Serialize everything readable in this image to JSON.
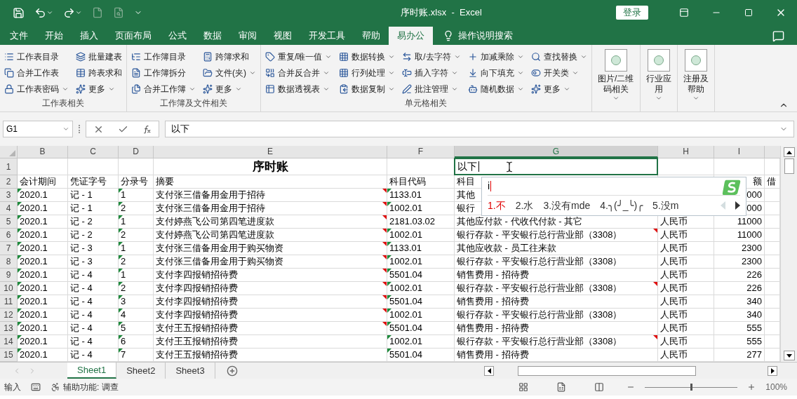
{
  "window": {
    "title": "序时账.xlsx  -  Excel",
    "sign_in": "登录"
  },
  "tabs": [
    {
      "label": "文件",
      "selected": false
    },
    {
      "label": "开始",
      "selected": false
    },
    {
      "label": "插入",
      "selected": false
    },
    {
      "label": "页面布局",
      "selected": false
    },
    {
      "label": "公式",
      "selected": false
    },
    {
      "label": "数据",
      "selected": false
    },
    {
      "label": "审阅",
      "selected": false
    },
    {
      "label": "视图",
      "selected": false
    },
    {
      "label": "开发工具",
      "selected": false
    },
    {
      "label": "帮助",
      "selected": false
    },
    {
      "label": "易办公",
      "selected": true
    }
  ],
  "tell_me": "操作说明搜索",
  "ribbon": {
    "groups": [
      {
        "label": "工作表相关",
        "columns": [
          [
            {
              "label": "工作表目录",
              "dropdown": false
            },
            {
              "label": "合并工作表",
              "dropdown": false
            },
            {
              "label": "工作表密码",
              "dropdown": true
            }
          ],
          [
            {
              "label": "批量建表",
              "dropdown": false
            },
            {
              "label": "跨表求和",
              "dropdown": false
            },
            {
              "label": "更多",
              "dropdown": true
            }
          ]
        ]
      },
      {
        "label": "工作簿及文件相关",
        "columns": [
          [
            {
              "label": "工作簿目录",
              "dropdown": false
            },
            {
              "label": "工作簿拆分",
              "dropdown": false
            },
            {
              "label": "合并工作簿",
              "dropdown": true
            }
          ],
          [
            {
              "label": "跨簿求和",
              "dropdown": false
            },
            {
              "label": "文件(夹)",
              "dropdown": true
            },
            {
              "label": "更多",
              "dropdown": true
            }
          ]
        ]
      },
      {
        "label": "单元格相关",
        "columns": [
          [
            {
              "label": "重复/唯一值",
              "dropdown": true
            },
            {
              "label": "合并反合并",
              "dropdown": true
            },
            {
              "label": "数据透视表",
              "dropdown": true
            }
          ],
          [
            {
              "label": "数据转换",
              "dropdown": true
            },
            {
              "label": "行列处理",
              "dropdown": true
            },
            {
              "label": "数据复制",
              "dropdown": true
            }
          ],
          [
            {
              "label": "取/去字符",
              "dropdown": true
            },
            {
              "label": "插入字符",
              "dropdown": true
            },
            {
              "label": "批注管理",
              "dropdown": true
            }
          ],
          [
            {
              "label": "加减乘除",
              "dropdown": true
            },
            {
              "label": "向下填充",
              "dropdown": true
            },
            {
              "label": "随机数据",
              "dropdown": true
            }
          ],
          [
            {
              "label": "查找替换",
              "dropdown": true
            },
            {
              "label": "开关类",
              "dropdown": true
            },
            {
              "label": "更多",
              "dropdown": true
            }
          ]
        ]
      }
    ],
    "large_buttons": [
      {
        "label": "图片/二维码相关"
      },
      {
        "label": "行业应用"
      },
      {
        "label": "注册及帮助"
      }
    ]
  },
  "formula_bar": {
    "name_box": "G1",
    "value": "以下"
  },
  "sheet": {
    "columns": [
      {
        "letter": "B",
        "selected": false
      },
      {
        "letter": "C",
        "selected": false
      },
      {
        "letter": "D",
        "selected": false
      },
      {
        "letter": "E",
        "selected": false
      },
      {
        "letter": "F",
        "selected": false
      },
      {
        "letter": "G",
        "selected": true
      },
      {
        "letter": "H",
        "selected": false
      },
      {
        "letter": "I",
        "selected": false
      }
    ],
    "rows": [
      {
        "num": "1",
        "kind": "title",
        "cells": [
          null,
          null,
          null,
          {
            "text": "序时账"
          },
          null,
          {
            "text": "以下",
            "active": true
          }
        ]
      },
      {
        "num": "2",
        "kind": "data",
        "cells": [
          {
            "text": "会计期间"
          },
          {
            "text": "凭证字号"
          },
          {
            "text": "分录号"
          },
          {
            "text": "摘要"
          },
          {
            "text": "科目代码"
          },
          {
            "text": "科目"
          },
          null,
          {
            "text": "额"
          },
          {
            "text": "借"
          }
        ]
      },
      {
        "num": "3",
        "kind": "data",
        "cells": [
          {
            "text": "2020.1",
            "error": true
          },
          {
            "text": "记 - 1"
          },
          {
            "text": "1",
            "error": true
          },
          {
            "text": "支付张三借备用金用于招待",
            "note": true
          },
          {
            "text": "1133.01",
            "error": true
          },
          {
            "text": "其他"
          },
          null,
          {
            "text": "000"
          }
        ]
      },
      {
        "num": "4",
        "kind": "data",
        "cells": [
          {
            "text": "2020.1",
            "error": true
          },
          {
            "text": "记 - 1"
          },
          {
            "text": "2",
            "error": true
          },
          {
            "text": "支付张三借备用金用于招待",
            "note": true
          },
          {
            "text": "1002.01",
            "error": true
          },
          {
            "text": "银行"
          },
          null,
          {
            "text": "000"
          }
        ]
      },
      {
        "num": "5",
        "kind": "data",
        "cells": [
          {
            "text": "2020.1",
            "error": true
          },
          {
            "text": "记 - 2"
          },
          {
            "text": "1",
            "error": true
          },
          {
            "text": "支付婷燕飞公司第四笔进度款",
            "note": true
          },
          {
            "text": "2181.03.02"
          },
          {
            "text": "其他应付款 - 代收代付款 - 其它"
          },
          {
            "text": "人民币"
          },
          {
            "text": "11000"
          }
        ]
      },
      {
        "num": "6",
        "kind": "data",
        "cells": [
          {
            "text": "2020.1",
            "error": true
          },
          {
            "text": "记 - 2"
          },
          {
            "text": "2",
            "error": true
          },
          {
            "text": "支付婷燕飞公司第四笔进度款",
            "note": true
          },
          {
            "text": "1002.01",
            "error": true
          },
          {
            "text": "银行存款 - 平安银行总行营业部（3308）",
            "note": true
          },
          {
            "text": "人民币"
          },
          {
            "text": "11000"
          }
        ]
      },
      {
        "num": "7",
        "kind": "data",
        "cells": [
          {
            "text": "2020.1",
            "error": true
          },
          {
            "text": "记 - 3"
          },
          {
            "text": "1",
            "error": true
          },
          {
            "text": "支付张三借备用金用于购买物资",
            "note": true
          },
          {
            "text": "1133.01",
            "error": true
          },
          {
            "text": "其他应收款 - 员工往来款"
          },
          {
            "text": "人民币"
          },
          {
            "text": "2300"
          }
        ]
      },
      {
        "num": "8",
        "kind": "data",
        "cells": [
          {
            "text": "2020.1",
            "error": true
          },
          {
            "text": "记 - 3"
          },
          {
            "text": "2",
            "error": true
          },
          {
            "text": "支付张三借备用金用于购买物资",
            "note": true
          },
          {
            "text": "1002.01",
            "error": true
          },
          {
            "text": "银行存款 - 平安银行总行营业部（3308）"
          },
          {
            "text": "人民币"
          },
          {
            "text": "2300"
          }
        ]
      },
      {
        "num": "9",
        "kind": "data",
        "cells": [
          {
            "text": "2020.1",
            "error": true
          },
          {
            "text": "记 - 4"
          },
          {
            "text": "1",
            "error": true
          },
          {
            "text": "支付李四报销招待费",
            "note": true
          },
          {
            "text": "5501.04",
            "error": true
          },
          {
            "text": "销售费用 - 招待费"
          },
          {
            "text": "人民币"
          },
          {
            "text": "226"
          }
        ]
      },
      {
        "num": "10",
        "kind": "data",
        "cells": [
          {
            "text": "2020.1",
            "error": true
          },
          {
            "text": "记 - 4"
          },
          {
            "text": "2",
            "error": true
          },
          {
            "text": "支付李四报销招待费",
            "note": true
          },
          {
            "text": "1002.01",
            "error": true
          },
          {
            "text": "银行存款 - 平安银行总行营业部（3308）",
            "note": true
          },
          {
            "text": "人民币"
          },
          {
            "text": "226"
          }
        ]
      },
      {
        "num": "11",
        "kind": "data",
        "cells": [
          {
            "text": "2020.1",
            "error": true
          },
          {
            "text": "记 - 4"
          },
          {
            "text": "3",
            "error": true
          },
          {
            "text": "支付李四报销招待费",
            "note": true
          },
          {
            "text": "5501.04",
            "error": true
          },
          {
            "text": "销售费用 - 招待费"
          },
          {
            "text": "人民币"
          },
          {
            "text": "340"
          }
        ]
      },
      {
        "num": "12",
        "kind": "data",
        "cells": [
          {
            "text": "2020.1",
            "error": true
          },
          {
            "text": "记 - 4"
          },
          {
            "text": "4",
            "error": true
          },
          {
            "text": "支付李四报销招待费",
            "note": true
          },
          {
            "text": "1002.01",
            "error": true
          },
          {
            "text": "银行存款 - 平安银行总行营业部（3308）"
          },
          {
            "text": "人民币"
          },
          {
            "text": "340"
          }
        ]
      },
      {
        "num": "13",
        "kind": "data",
        "cells": [
          {
            "text": "2020.1",
            "error": true
          },
          {
            "text": "记 - 4"
          },
          {
            "text": "5",
            "error": true
          },
          {
            "text": "支付王五报销招待费",
            "note": true
          },
          {
            "text": "5501.04",
            "error": true
          },
          {
            "text": "销售费用 - 招待费"
          },
          {
            "text": "人民币"
          },
          {
            "text": "555"
          }
        ]
      },
      {
        "num": "14",
        "kind": "data",
        "cells": [
          {
            "text": "2020.1",
            "error": true
          },
          {
            "text": "记 - 4"
          },
          {
            "text": "6",
            "error": true
          },
          {
            "text": "支付王五报销招待费"
          },
          {
            "text": "1002.01",
            "error": true
          },
          {
            "text": "银行存款 - 平安银行总行营业部（3308）",
            "note": true
          },
          {
            "text": "人民币"
          },
          {
            "text": "555"
          }
        ]
      },
      {
        "num": "15",
        "kind": "data",
        "cells": [
          {
            "text": "2020.1",
            "error": true
          },
          {
            "text": "记 - 4"
          },
          {
            "text": "7",
            "error": true
          },
          {
            "text": "支付王五报销招待费"
          },
          {
            "text": "5501.04",
            "error": true
          },
          {
            "text": "销售费用 - 招待费"
          },
          {
            "text": "人民币"
          },
          {
            "text": "277"
          }
        ]
      }
    ]
  },
  "ime": {
    "input": "i",
    "candidates": [
      {
        "text": "1.不",
        "selected": true
      },
      {
        "text": "2.水",
        "selected": false
      },
      {
        "text": "3.没有mde",
        "selected": false
      },
      {
        "text": "4.╮(╯_╰)╭",
        "selected": false
      },
      {
        "text": "5.没m",
        "selected": false
      }
    ],
    "prev_enabled": false,
    "next_enabled": true
  },
  "sheets": [
    {
      "label": "Sheet1",
      "selected": true
    },
    {
      "label": "Sheet2",
      "selected": false
    },
    {
      "label": "Sheet3",
      "selected": false
    }
  ],
  "status": {
    "mode": "输入",
    "accessibility": "辅助功能: 调查",
    "zoom": "100%",
    "zoom_slider": {
      "level": 0.5
    }
  }
}
